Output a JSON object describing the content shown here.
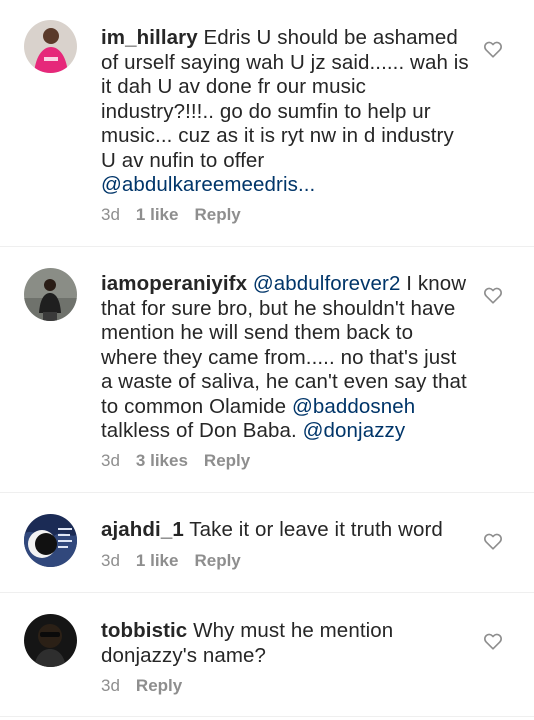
{
  "comments": [
    {
      "username": "im_hillary",
      "text": " Edris U should be ashamed of urself saying wah U jz said...... wah is it dah U av done fr our music industry?!!!.. go do sumfin to help ur music... cuz as it is ryt nw in d industry U av nufin to offer ",
      "mention_tail": "@abdulkareemeedris...",
      "time": "3d",
      "likes": "1 like",
      "reply": "Reply"
    },
    {
      "username": "iamoperaniyifx",
      "mention_lead": "@abdulforever2",
      "text": " I know that for sure bro, but he shouldn't have mention he will send them back to where they came from..... no that's just a waste of saliva, he can't even say that to common Olamide  ",
      "mention_mid": "@baddosneh",
      "text2": " talkless of Don Baba. ",
      "mention_tail": "@donjazzy",
      "time": "3d",
      "likes": "3 likes",
      "reply": "Reply"
    },
    {
      "username": "ajahdi_1",
      "text": " Take it or leave it truth word",
      "time": "3d",
      "likes": "1 like",
      "reply": "Reply"
    },
    {
      "username": "tobbistic",
      "text": " Why must he mention donjazzy's name?",
      "time": "3d",
      "reply": "Reply"
    }
  ],
  "icons": {
    "like": "heart-outline-icon"
  },
  "colors": {
    "text": "#262626",
    "mention": "#003569",
    "meta": "#8e8e8e",
    "divider": "#efefef"
  }
}
